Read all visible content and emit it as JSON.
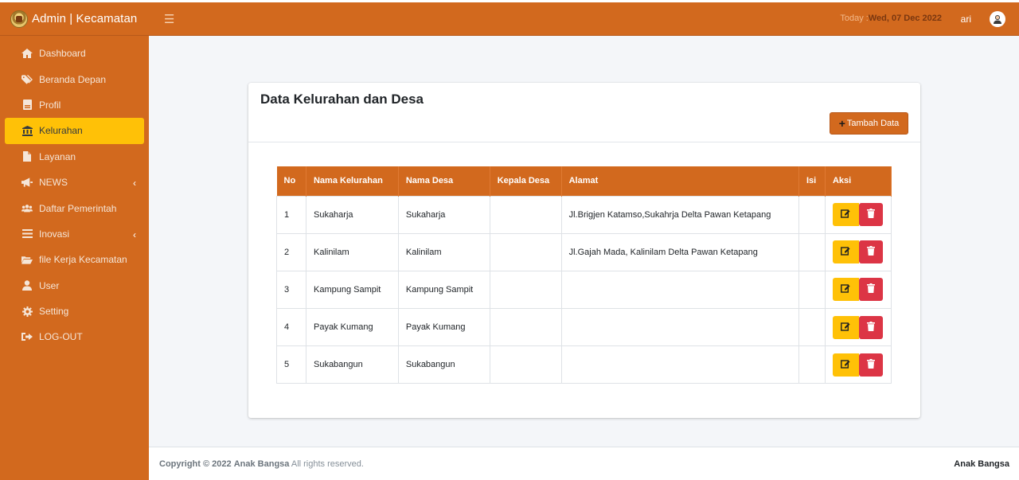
{
  "brand": {
    "title": "Admin | Kecamatan",
    "logo_icon": "kecamatan-emblem-icon"
  },
  "header": {
    "menu_icon": "hamburger-icon",
    "today_label": "Today :",
    "today_value": "Wed, 07 Dec 2022",
    "username": "ari",
    "avatar_icon": "user-avatar-icon"
  },
  "sidebar": {
    "items": [
      {
        "label": "Dashboard",
        "icon": "home-icon"
      },
      {
        "label": "Beranda Depan",
        "icon": "tags-icon"
      },
      {
        "label": "Profil",
        "icon": "id-card-icon"
      },
      {
        "label": "Kelurahan",
        "icon": "landmark-icon",
        "active": true
      },
      {
        "label": "Layanan",
        "icon": "file-icon"
      },
      {
        "label": "NEWS",
        "icon": "bullhorn-icon",
        "has_submenu": true
      },
      {
        "label": "Daftar Pemerintah",
        "icon": "users-icon"
      },
      {
        "label": "Inovasi",
        "icon": "list-icon",
        "has_submenu": true
      },
      {
        "label": "file Kerja Kecamatan",
        "icon": "folder-open-icon"
      },
      {
        "label": "User",
        "icon": "user-icon"
      },
      {
        "label": "Setting",
        "icon": "cog-icon"
      },
      {
        "label": "LOG-OUT",
        "icon": "sign-out-icon"
      }
    ]
  },
  "card": {
    "title": "Data Kelurahan dan Desa",
    "add_button": "Tambah Data"
  },
  "table": {
    "columns": [
      "No",
      "Nama Kelurahan",
      "Nama Desa",
      "Kepala Desa",
      "Alamat",
      "Isi",
      "Aksi"
    ],
    "rows": [
      {
        "no": "1",
        "kelurahan": "Sukaharja",
        "desa": "Sukaharja",
        "kepala": "",
        "alamat": "Jl.Brigjen Katamso,Sukahrja Delta Pawan Ketapang",
        "isi": ""
      },
      {
        "no": "2",
        "kelurahan": "Kalinilam",
        "desa": "Kalinilam",
        "kepala": "",
        "alamat": "Jl.Gajah Mada, Kalinilam Delta Pawan Ketapang",
        "isi": ""
      },
      {
        "no": "3",
        "kelurahan": "Kampung Sampit",
        "desa": "Kampung Sampit",
        "kepala": "",
        "alamat": "",
        "isi": ""
      },
      {
        "no": "4",
        "kelurahan": "Payak Kumang",
        "desa": "Payak Kumang",
        "kepala": "",
        "alamat": "",
        "isi": ""
      },
      {
        "no": "5",
        "kelurahan": "Sukabangun",
        "desa": "Sukabangun",
        "kepala": "",
        "alamat": "",
        "isi": ""
      }
    ]
  },
  "footer": {
    "copyright_prefix": "Copyright © 2022",
    "copyright_brand": "Anak Bangsa",
    "copyright_suffix": "All rights reserved.",
    "right_text": "Anak Bangsa"
  },
  "colors": {
    "primary": "#d2691e",
    "active": "#ffc107",
    "danger": "#dc3545"
  }
}
